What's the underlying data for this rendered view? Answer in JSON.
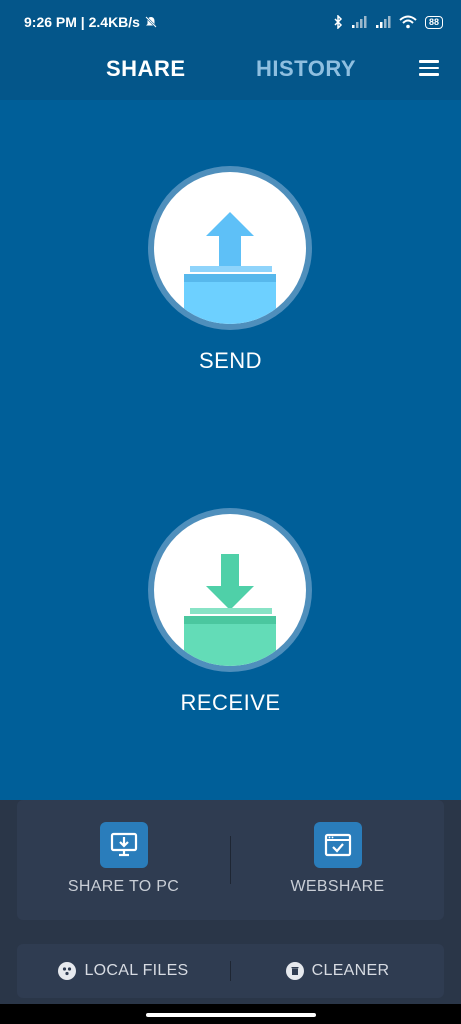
{
  "status_bar": {
    "time_speed": "9:26 PM | 2.4KB/s",
    "battery": "88"
  },
  "nav": {
    "tabs": [
      {
        "label": "SHARE",
        "active": true
      },
      {
        "label": "HISTORY",
        "active": false
      }
    ],
    "menu_icon": "hamburger-menu-icon"
  },
  "actions": {
    "send_label": "SEND",
    "receive_label": "RECEIVE"
  },
  "tools": {
    "share_to_pc_label": "SHARE TO PC",
    "webshare_label": "WEBSHARE",
    "local_files_label": "LOCAL FILES",
    "cleaner_label": "CLEANER"
  },
  "colors": {
    "primary": "#005f99",
    "header": "#04568a",
    "send_accent": "#64c8ff",
    "receive_accent": "#5fdcb6",
    "panel": "#2f3c51"
  }
}
